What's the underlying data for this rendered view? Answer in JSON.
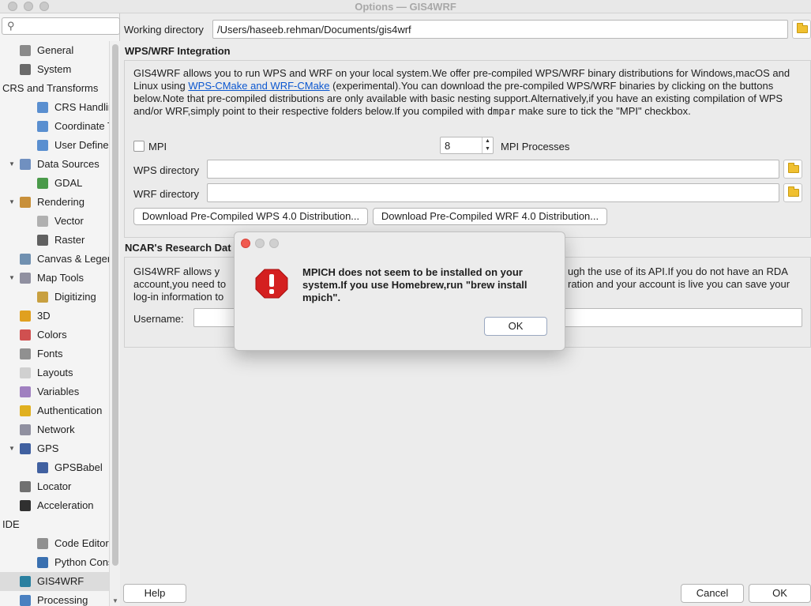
{
  "window": {
    "title": "Options — GIS4WRF"
  },
  "search": {
    "placeholder": ""
  },
  "sidebar": {
    "items": [
      {
        "label": "General",
        "icon": "wrench-icon",
        "color": "#8a8a8a"
      },
      {
        "label": "System",
        "icon": "gear-icon",
        "color": "#6a6a6a"
      },
      {
        "label": "CRS and Transforms",
        "icon": "",
        "color": ""
      },
      {
        "label": "CRS Handling",
        "icon": "globe-icon",
        "color": "#5a8fd0"
      },
      {
        "label": "Coordinate Transforms",
        "icon": "globe-icon",
        "color": "#5a8fd0"
      },
      {
        "label": "User Defined CRS",
        "icon": "globe-icon",
        "color": "#5a8fd0"
      },
      {
        "label": "Data Sources",
        "icon": "table-icon",
        "color": "#7090c0"
      },
      {
        "label": "GDAL",
        "icon": "gdal-icon",
        "color": "#4a9a4a"
      },
      {
        "label": "Rendering",
        "icon": "brush-icon",
        "color": "#c8903a"
      },
      {
        "label": "Vector",
        "icon": "vector-icon",
        "color": "#b0b0b0"
      },
      {
        "label": "Raster",
        "icon": "raster-icon",
        "color": "#606060"
      },
      {
        "label": "Canvas & Legend",
        "icon": "canvas-icon",
        "color": "#7090b0"
      },
      {
        "label": "Map Tools",
        "icon": "map-tools-icon",
        "color": "#9090a0"
      },
      {
        "label": "Digitizing",
        "icon": "digitizing-icon",
        "color": "#c8a040"
      },
      {
        "label": "3D",
        "icon": "cube-icon",
        "color": "#e0a020"
      },
      {
        "label": "Colors",
        "icon": "palette-icon",
        "color": "#d05050"
      },
      {
        "label": "Fonts",
        "icon": "font-icon",
        "color": "#909090"
      },
      {
        "label": "Layouts",
        "icon": "layout-icon",
        "color": "#d0d0d0"
      },
      {
        "label": "Variables",
        "icon": "variables-icon",
        "color": "#a080c0"
      },
      {
        "label": "Authentication",
        "icon": "lock-icon",
        "color": "#e0b020"
      },
      {
        "label": "Network",
        "icon": "network-icon",
        "color": "#9090a0"
      },
      {
        "label": "GPS",
        "icon": "gps-icon",
        "color": "#4060a0"
      },
      {
        "label": "GPSBabel",
        "icon": "gps-icon",
        "color": "#4060a0"
      },
      {
        "label": "Locator",
        "icon": "search-icon",
        "color": "#707070"
      },
      {
        "label": "Acceleration",
        "icon": "chip-icon",
        "color": "#303030"
      },
      {
        "label": "IDE",
        "icon": "",
        "color": ""
      },
      {
        "label": "Code Editor",
        "icon": "code-icon",
        "color": "#909090"
      },
      {
        "label": "Python Console",
        "icon": "python-icon",
        "color": "#3a70b0"
      },
      {
        "label": "GIS4WRF",
        "icon": "gis4wrf-icon",
        "color": "#2a80a0"
      },
      {
        "label": "Processing",
        "icon": "gear-icon",
        "color": "#4a80c0"
      }
    ]
  },
  "main": {
    "working_directory_label": "Working directory",
    "working_directory_value": "/Users/haseeb.rehman/Documents/gis4wrf",
    "wps_section_title": "WPS/WRF Integration",
    "wps_paragraph_1": "GIS4WRF allows you to run WPS and WRF on your local system.We offer pre-compiled WPS/WRF binary distributions for Windows,macOS and Linux using ",
    "wps_link": "WPS-CMake and WRF-CMake",
    "wps_paragraph_2": " (experimental).You can download the pre-compiled WPS/WRF binaries by clicking on the buttons below.Note that pre-compiled distributions are only available with basic nesting support.Alternatively,if you have an existing compilation of WPS and/or WRF,simply point to their respective folders below.If you compiled with ",
    "wps_code": "dmpar",
    "wps_paragraph_3": " make sure to tick the \"MPI\" checkbox.",
    "mpi_label": "MPI",
    "mpi_processes_value": "8",
    "mpi_processes_label": "MPI Processes",
    "wps_dir_label": "WPS directory",
    "wrf_dir_label": "WRF directory",
    "download_wps_label": "Download Pre-Compiled WPS 4.0 Distribution...",
    "download_wrf_label": "Download Pre-Compiled WRF 4.0 Distribution...",
    "ncar_section_title": "NCAR's Research Dat",
    "ncar_text_a": "GIS4WRF allows y",
    "ncar_text_b": "ugh the use of its API.If you do not have an RDA",
    "ncar_text_c": "account,you need to ",
    "ncar_text_d": "ration and your account is live you can save your",
    "ncar_text_e": "log-in information to",
    "username_label": "Username:"
  },
  "footer": {
    "help_label": "Help",
    "cancel_label": "Cancel",
    "ok_label": "OK"
  },
  "dialog": {
    "message": "MPICH does not seem to be installed on your system.If you use Homebrew,run \"brew install mpich\".",
    "ok_label": "OK",
    "icon": "alert-icon",
    "icon_color": "#d42020"
  }
}
